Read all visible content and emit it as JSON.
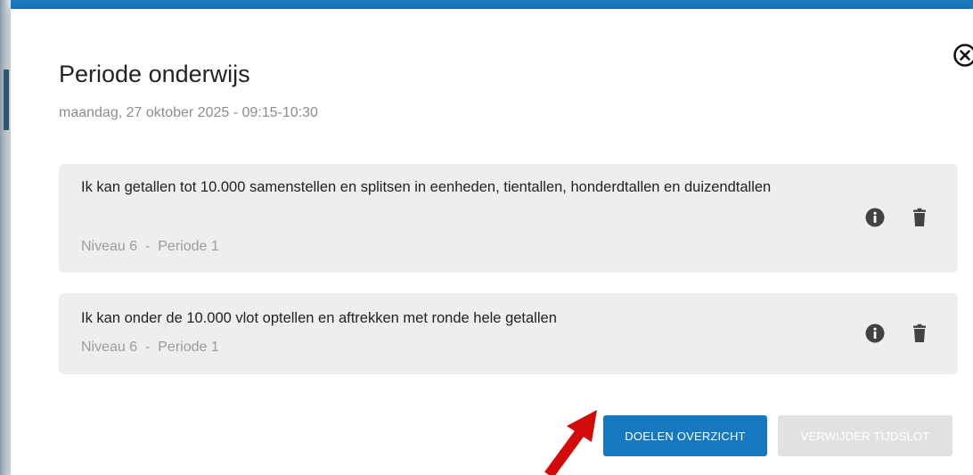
{
  "dialog": {
    "title": "Periode onderwijs",
    "subtitle": "maandag, 27 oktober 2025 - 09:15-10:30",
    "close_icon": "close-circle-icon"
  },
  "goals": [
    {
      "text": "Ik kan getallen tot 10.000 samenstellen en splitsen in eenheden, tientallen, honderdtallen en duizendtallen",
      "meta": "Niveau 6  -  Periode 1",
      "icons": [
        "info-icon",
        "trash-icon"
      ]
    },
    {
      "text": "Ik kan onder de 10.000 vlot optellen en aftrekken met ronde hele getallen",
      "meta": "Niveau 6  -  Periode 1",
      "icons": [
        "info-icon",
        "trash-icon"
      ]
    }
  ],
  "buttons": {
    "primary_label": "DOELEN OVERZICHT",
    "secondary_label": "VERWIJDER TIJDSLOT",
    "secondary_disabled": true
  },
  "annotation": {
    "arrow_color": "#d10a0a",
    "points_to": "DOELEN OVERZICHT"
  },
  "colors": {
    "primary": "#1679c0",
    "card_bg": "#eeeeee",
    "muted_text": "#9b9b9b",
    "disabled_bg": "#e1e1e1"
  }
}
